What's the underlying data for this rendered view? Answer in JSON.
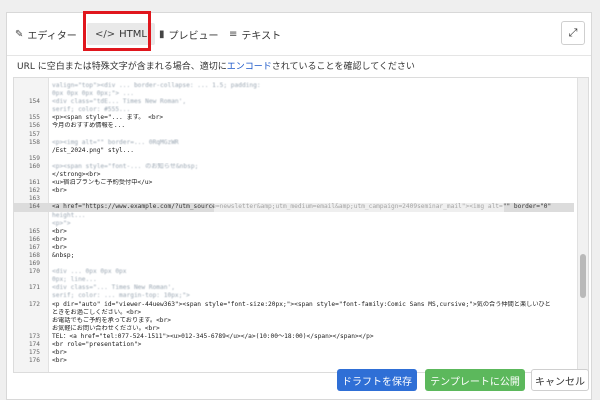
{
  "tabs": [
    {
      "icon": "edit-icon",
      "label": "エディター"
    },
    {
      "icon": "code-icon",
      "label": "HTML"
    },
    {
      "icon": "preview-icon",
      "label": "プレビュー"
    },
    {
      "icon": "text-icon",
      "label": "テキスト"
    }
  ],
  "notice": {
    "before": "URL に空白または特殊文字が含まれる場合、適切に",
    "link": "エンコード",
    "after": "されていることを確認してください"
  },
  "editor": {
    "lines": [
      {
        "n": "",
        "code": "valign=\"top\"><div ... border-collapse: ... 1.5; padding:"
      },
      {
        "n": "",
        "code": "0px 0px 0px 0px;\"> ... "
      },
      {
        "n": "154",
        "code": "<div class=\"tdE... Times New Roman',"
      },
      {
        "n": "",
        "code": "serif; color: #555..."
      },
      {
        "n": "155",
        "code": "<p><span style=\"... ます。 <br>"
      },
      {
        "n": "156",
        "code": "今月のおすすめ情報を..."
      },
      {
        "n": "157",
        "code": ""
      },
      {
        "n": "158",
        "code": "<p><img alt=\"\" border=... 0RqMGzWR"
      },
      {
        "n": "",
        "code": "/Est_2024.png\" styl..."
      },
      {
        "n": "159",
        "code": ""
      },
      {
        "n": "160",
        "code": "<p><span style=\"font-... のお知らせ&nbsp;"
      },
      {
        "n": "",
        "code": "</strong><br>"
      },
      {
        "n": "161",
        "code": "<u>宿泊プランもご予約受付中</u>"
      },
      {
        "n": "162",
        "code": "<br>"
      },
      {
        "n": "163",
        "code": ""
      },
      {
        "n": "164",
        "code": "<a href=\"https://www.example.com/?utm_source=newsletter&amp;utm_medium=email&amp;utm_campaign=2409seminar_mail\"><img alt=\"\" border=\"0\""
      },
      {
        "n": "",
        "code": "height..."
      },
      {
        "n": "",
        "code": "<p>\">"
      },
      {
        "n": "165",
        "code": "<br>"
      },
      {
        "n": "166",
        "code": "<br>"
      },
      {
        "n": "167",
        "code": "<br>"
      },
      {
        "n": "168",
        "code": "&nbsp;"
      },
      {
        "n": "169",
        "code": ""
      },
      {
        "n": "170",
        "code": "<div ... 0px 0px 0px"
      },
      {
        "n": "",
        "code": "0px; line..."
      },
      {
        "n": "171",
        "code": "<div class=\"... Times New Roman',"
      },
      {
        "n": "",
        "code": "serif; color: ... margin-top: 10px;\">"
      },
      {
        "n": "172",
        "code": "<p dir=\"auto\" id=\"viewer-44uew363\"><span style=\"font-size:20px;\"><span style=\"font-family:Comic Sans MS,cursive;\">気の合う仲間と楽しいひと"
      },
      {
        "n": "",
        "code": "ときをお過ごしください。<br>"
      },
      {
        "n": "",
        "code": "お電話でもご予約を承っております。<br>"
      },
      {
        "n": "",
        "code": "お気軽にお問い合わせください。<br>"
      },
      {
        "n": "173",
        "code": "TEL：<a href=\"tel:077-524-1511\"><u>012-345-6789</u></a>(10:00～18:00)</span></span></p>"
      },
      {
        "n": "174",
        "code": "<br role=\"presentation\">"
      },
      {
        "n": "175",
        "code": "<br>"
      },
      {
        "n": "176",
        "code": "<br>"
      }
    ]
  },
  "buttons": {
    "draft": "ドラフトを保存",
    "publish": "テンプレートに公開",
    "cancel": "キャンセル"
  }
}
